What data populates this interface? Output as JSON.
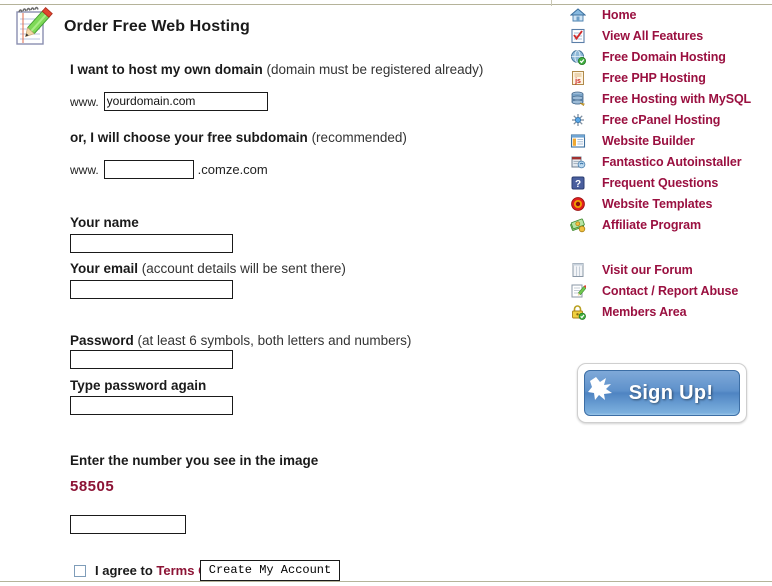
{
  "header": {
    "title": "Order Free Web Hosting",
    "icon": "notepad-pencil-icon"
  },
  "form": {
    "own_domain": {
      "label_bold": "I want to host my own domain",
      "label_note": " (domain must be registered already)",
      "prefix": "www.",
      "value": "yourdomain.com",
      "placeholder": ""
    },
    "subdomain": {
      "label_bold": "or, I will choose your free subdomain",
      "label_note": " (recommended)",
      "prefix": "www.",
      "value": "",
      "placeholder": "",
      "suffix": ".comze.com"
    },
    "name": {
      "label": "Your name",
      "value": "",
      "placeholder": ""
    },
    "email": {
      "label": "Your email",
      "note": " (account details will be sent there)",
      "value": "",
      "placeholder": ""
    },
    "password": {
      "label": "Password",
      "note": " (at least 6 symbols, both letters and numbers)",
      "value": "",
      "placeholder": ""
    },
    "password_again": {
      "label": "Type password again",
      "value": "",
      "placeholder": ""
    },
    "captcha": {
      "label": "Enter the number you see in the image",
      "image_number": "58505",
      "value": "",
      "placeholder": ""
    },
    "agreement": {
      "checked": false,
      "text": "I agree to ",
      "link_text": "Terms Of Service"
    },
    "submit_label": "Create My Account"
  },
  "sidebar": {
    "items": [
      {
        "label": "Home",
        "icon": "home-icon"
      },
      {
        "label": "View All Features",
        "icon": "checklist-icon"
      },
      {
        "label": "Free Domain Hosting",
        "icon": "globe-check-icon"
      },
      {
        "label": "Free PHP Hosting",
        "icon": "script-js-icon"
      },
      {
        "label": "Free Hosting with MySQL",
        "icon": "database-icon"
      },
      {
        "label": "Free cPanel Hosting",
        "icon": "cpanel-star-icon"
      },
      {
        "label": "Website Builder",
        "icon": "window-layout-icon"
      },
      {
        "label": "Fantastico Autoinstaller",
        "icon": "installer-box-icon"
      },
      {
        "label": "Frequent Questions",
        "icon": "question-mark-icon"
      },
      {
        "label": "Website Templates",
        "icon": "target-ring-icon"
      },
      {
        "label": "Affiliate Program",
        "icon": "money-cash-icon"
      }
    ],
    "items_group2": [
      {
        "label": "Visit our Forum",
        "icon": "forum-board-icon"
      },
      {
        "label": "Contact / Report Abuse",
        "icon": "contact-pencil-icon"
      },
      {
        "label": "Members Area",
        "icon": "padlock-check-icon"
      }
    ],
    "signup": {
      "label": "Sign Up!",
      "icon": "starburst-icon"
    }
  },
  "colors": {
    "link_red": "#9a1040",
    "captcha_red": "#8c1335",
    "text_dark": "#1a1a1a",
    "signup_blue": "#4f84c2",
    "rule": "#b5b39a"
  }
}
